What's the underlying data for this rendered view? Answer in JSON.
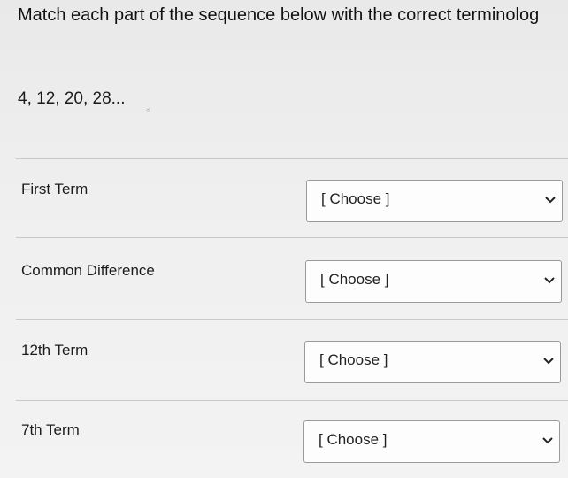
{
  "question": {
    "text": "Match each part of the sequence below with the correct terminolog",
    "sequence": "4, 12, 20, 28..."
  },
  "rows": [
    {
      "label": "First Term",
      "select_value": "[ Choose ]"
    },
    {
      "label": "Common Difference",
      "select_value": "[ Choose ]"
    },
    {
      "label": "12th Term",
      "select_value": "[ Choose ]"
    },
    {
      "label": "7th Term",
      "select_value": "[ Choose ]"
    }
  ],
  "icons": {
    "dropdown": "chevron-down-icon"
  }
}
